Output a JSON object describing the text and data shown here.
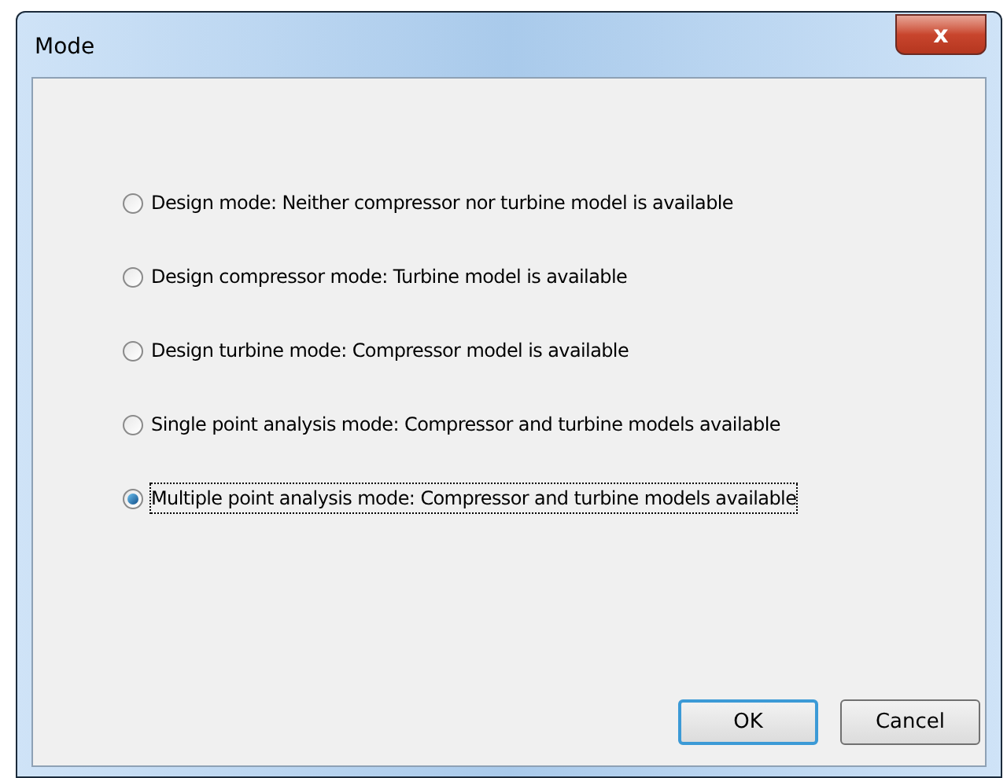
{
  "window": {
    "title": "Mode",
    "close_glyph": "x"
  },
  "options": [
    {
      "label": "Design mode: Neither compressor nor turbine model is available",
      "selected": false
    },
    {
      "label": "Design compressor mode: Turbine model is available",
      "selected": false
    },
    {
      "label": "Design turbine mode: Compressor model is available",
      "selected": false
    },
    {
      "label": "Single point analysis mode: Compressor and turbine models available",
      "selected": false
    },
    {
      "label": "Multiple point analysis mode: Compressor and turbine models available",
      "selected": true
    }
  ],
  "buttons": [
    {
      "label": "OK",
      "default": true
    },
    {
      "label": "Cancel",
      "default": false
    }
  ]
}
